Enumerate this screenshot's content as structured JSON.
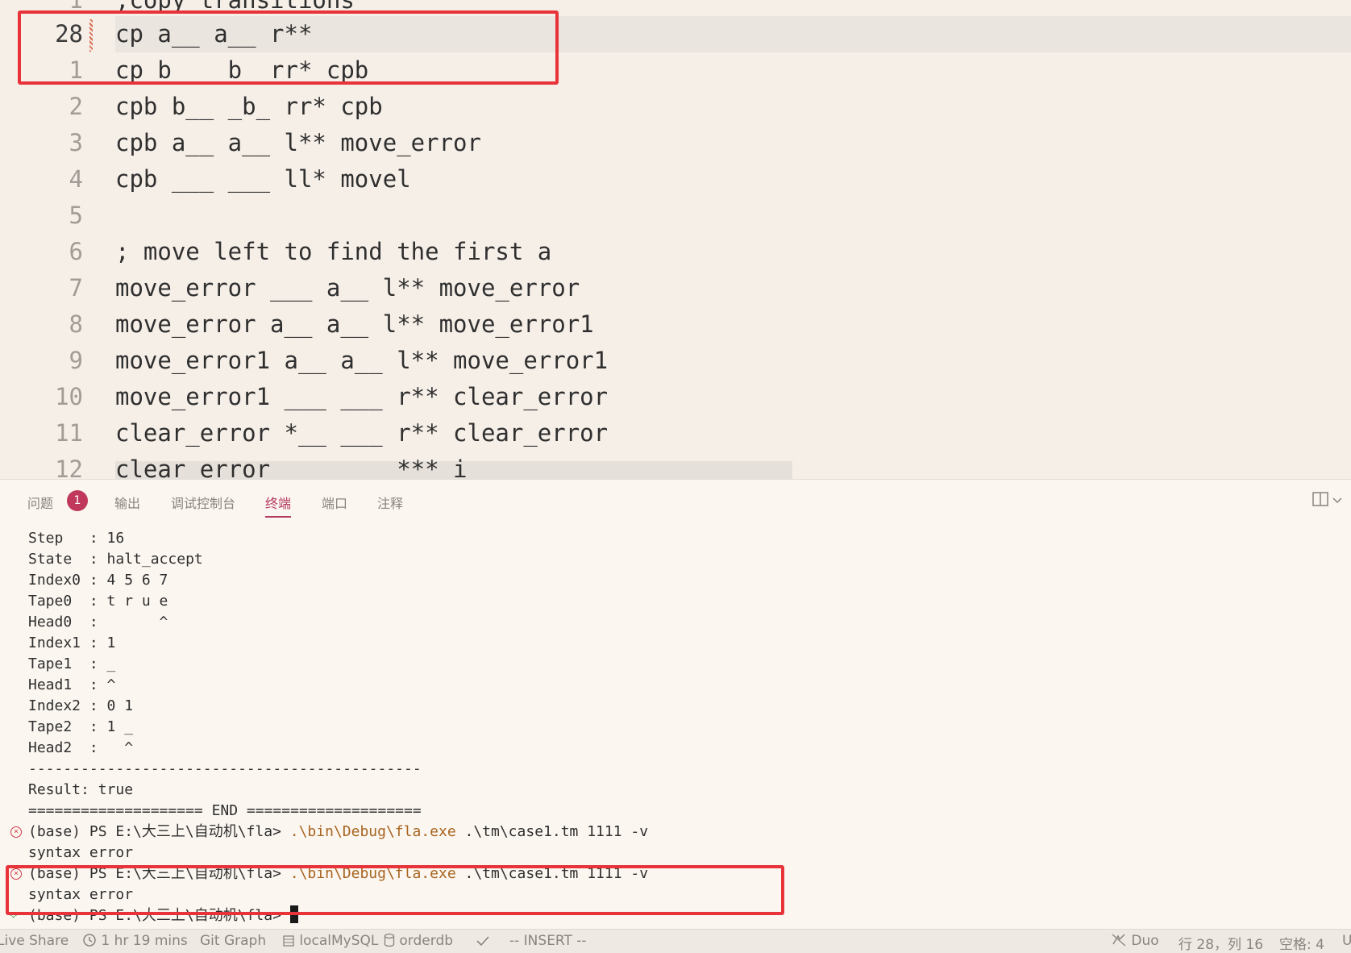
{
  "editor": {
    "lines": [
      {
        "num": "1",
        "text": ";copy transitions"
      },
      {
        "num": "28",
        "text": "cp a__ a__ r**",
        "current": true
      },
      {
        "num": "1",
        "text": "cp b__ _b_ rr* cpb"
      },
      {
        "num": "2",
        "text": "cpb b__ _b_ rr* cpb"
      },
      {
        "num": "3",
        "text": "cpb a__ a__ l** move_error"
      },
      {
        "num": "4",
        "text": "cpb ___ ___ ll* movel"
      },
      {
        "num": "5",
        "text": ""
      },
      {
        "num": "6",
        "text": "; move left to find the first a"
      },
      {
        "num": "7",
        "text": "move_error ___ a__ l** move_error"
      },
      {
        "num": "8",
        "text": "move_error a__ a__ l** move_error1"
      },
      {
        "num": "9",
        "text": "move_error1 a__ a__ l** move_error1"
      },
      {
        "num": "10",
        "text": "move_error1 ___ ___ r** clear_error"
      },
      {
        "num": "11",
        "text": "clear_error *__ ___ r** clear_error"
      },
      {
        "num": "12",
        "text": "clear_error         *** i"
      }
    ]
  },
  "panel": {
    "tabs": [
      {
        "label": "问题",
        "id": "problems"
      },
      {
        "label": "输出",
        "id": "output"
      },
      {
        "label": "调试控制台",
        "id": "debug-console"
      },
      {
        "label": "终端",
        "id": "terminal",
        "active": true
      },
      {
        "label": "端口",
        "id": "ports"
      },
      {
        "label": "注释",
        "id": "comments"
      }
    ],
    "problems_count": "1"
  },
  "terminal": {
    "lines": [
      "Step   : 16",
      "State  : halt_accept",
      "Index0 : 4 5 6 7",
      "Tape0  : t r u e",
      "Head0  :       ^",
      "Index1 : 1",
      "Tape1  : _",
      "Head1  : ^",
      "Index2 : 0 1",
      "Tape2  : 1 _",
      "Head2  :   ^",
      "---------------------------------------------",
      "Result: true",
      "==================== END ===================="
    ],
    "commands": [
      {
        "prompt": "(base) PS E:\\大三上\\自动机\\fla> ",
        "exe": ".\\bin\\Debug\\fla.exe",
        "args": " .\\tm\\case1.tm 1111 -v",
        "output": "syntax error"
      },
      {
        "prompt": "(base) PS E:\\大三上\\自动机\\fla> ",
        "exe": ".\\bin\\Debug\\fla.exe",
        "args": " .\\tm\\case1.tm 1111 -v",
        "output": "syntax error"
      }
    ],
    "current_prompt": "(base) PS E:\\大三上\\自动机\\fla> "
  },
  "statusbar": {
    "live_share": "Live Share",
    "time": "1 hr 19 mins",
    "git_graph": "Git Graph",
    "mysql": "localMySQL",
    "db": "orderdb",
    "mode": "-- INSERT --",
    "duo": "Duo",
    "position": "行 28，列 16",
    "spaces": "空格: 4",
    "encoding": "U"
  },
  "colors": {
    "accent": "#b43a62",
    "highlight_box": "#e8333b",
    "path": "#a8641f"
  }
}
